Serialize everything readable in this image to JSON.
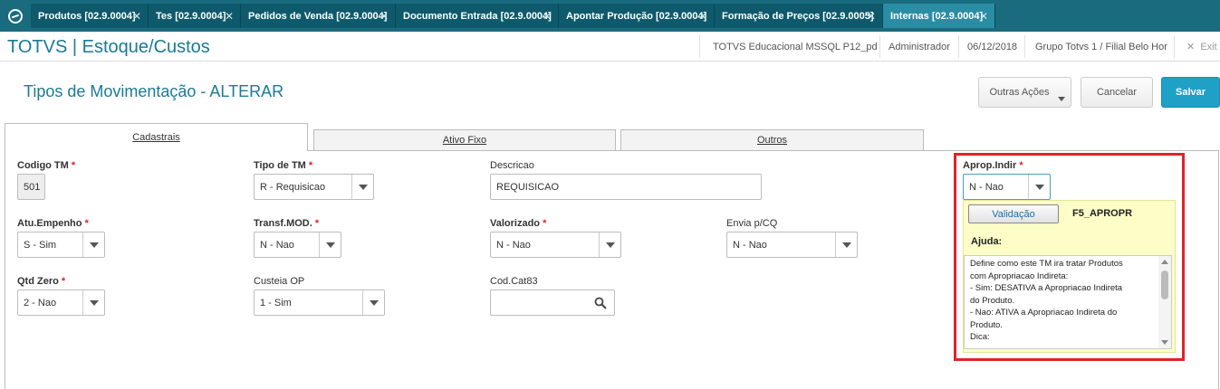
{
  "tabs": [
    {
      "label": "Produtos [02.9.0004]"
    },
    {
      "label": "Tes [02.9.0004]"
    },
    {
      "label": "Pedidos de Venda [02.9.0004]"
    },
    {
      "label": "Documento Entrada [02.9.0004]"
    },
    {
      "label": "Apontar Produção [02.9.0004]"
    },
    {
      "label": "Formação de Preços [02.9.0005]"
    },
    {
      "label": "Internas [02.9.0004]"
    }
  ],
  "header": {
    "app_title": "TOTVS | Estoque/Custos",
    "environment": "TOTVS Educacional MSSQL P12_pd",
    "user": "Administrador",
    "date": "06/12/2018",
    "company": "Grupo Totvs 1 / Filial Belo Hor",
    "exit": "Exit"
  },
  "page": {
    "title": "Tipos de Movimentação - ALTERAR",
    "other_actions": "Outras Ações",
    "cancel": "Cancelar",
    "save": "Salvar"
  },
  "folders": [
    "Cadastrais",
    "Ativo Fixo",
    "Outros"
  ],
  "form": {
    "codigo_tm": {
      "label": "Codigo TM",
      "value": "501"
    },
    "tipo_tm": {
      "label": "Tipo de TM",
      "value": "R - Requisicao"
    },
    "descricao": {
      "label": "Descricao",
      "value": "REQUISICAO"
    },
    "aprop_indir": {
      "label": "Aprop.Indir",
      "value": "N - Nao"
    },
    "atu_empenho": {
      "label": "Atu.Empenho",
      "value": "S - Sim"
    },
    "transf_mod": {
      "label": "Transf.MOD.",
      "value": "N - Nao"
    },
    "valorizado": {
      "label": "Valorizado",
      "value": "N - Nao"
    },
    "envia_cq": {
      "label": "Envia p/CQ",
      "value": "N - Nao"
    },
    "qtd_zero": {
      "label": "Qtd Zero",
      "value": "2 - Nao"
    },
    "custeia_op": {
      "label": "Custeia OP",
      "value": "1 - Sim"
    },
    "cod_cat83": {
      "label": "Cod.Cat83",
      "value": ""
    }
  },
  "required_mark": "*",
  "help": {
    "validation_button": "Validação",
    "field_name": "F5_APROPR",
    "title": "Ajuda:",
    "lines": [
      "Define como este TM ira tratar Produtos",
      "com Apropriacao Indireta:",
      "- Sim: DESATIVA a Apropriacao Indireta",
      "do Produto.",
      "- Nao: ATIVA a Apropriacao Indireta do",
      "Produto.",
      "Dica:"
    ]
  },
  "colors": {
    "tabbar": "#1a6b7e",
    "accent": "#1a7a9a",
    "primary_button": "#1fa0c6",
    "required": "#e0222b",
    "highlight": "#e0222b",
    "help_bg": "#fdfdc8"
  }
}
